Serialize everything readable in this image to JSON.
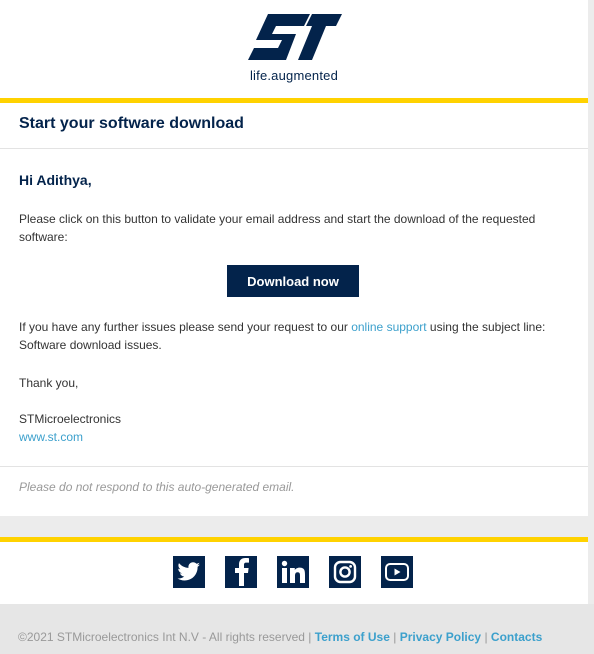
{
  "brand": {
    "logo_text": "ST",
    "tagline": "life.augmented",
    "navy": "#03234b",
    "accent_yellow": "#ffd200",
    "link_color": "#3ca0cc"
  },
  "email": {
    "title": "Start your software download",
    "greeting": "Hi Adithya,",
    "intro": "Please click on this button to validate your email address and start the download of the requested software:",
    "button_label": "Download now",
    "support_prefix": "If you have any further issues please send your request to our ",
    "support_link": "online support",
    "support_suffix": " using the subject line: Software download issues.",
    "thanks": "Thank you,",
    "signature": "STMicroelectronics",
    "website": "www.st.com",
    "note": "Please do not respond to this auto-generated email."
  },
  "social": [
    {
      "name": "twitter-icon"
    },
    {
      "name": "facebook-icon"
    },
    {
      "name": "linkedin-icon"
    },
    {
      "name": "instagram-icon"
    },
    {
      "name": "youtube-icon"
    }
  ],
  "footer": {
    "copyright": "©2021 STMicroelectronics Int N.V - All rights reserved",
    "separator": "|",
    "terms": "Terms of Use",
    "privacy": "Privacy Policy",
    "contacts": "Contacts"
  }
}
